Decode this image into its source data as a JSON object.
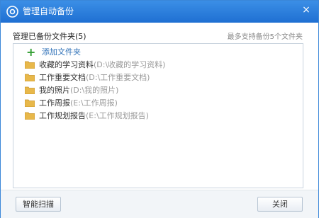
{
  "window": {
    "title": "管理自动备份",
    "close_glyph": "×"
  },
  "header": {
    "left_label": "管理已备份文件夹(5)",
    "right_hint": "最多支持备份5个文件夹"
  },
  "list": {
    "add_label": "添加文件夹",
    "add_icon": "plus-icon",
    "folders": [
      {
        "name": "收藏的学习资料",
        "path": "(D:\\收藏的学习资料)"
      },
      {
        "name": "工作重要文档",
        "path": "(D:\\工作重要文档)"
      },
      {
        "name": "我的照片",
        "path": "(D:\\我的照片)"
      },
      {
        "name": "工作周报",
        "path": "(E:\\工作周报)"
      },
      {
        "name": "工作规划报告",
        "path": "(E:\\工作规划报告)"
      }
    ]
  },
  "footer": {
    "scan_button": "智能扫描",
    "close_button": "关闭"
  },
  "colors": {
    "titlebar": "#1f6fd2",
    "folder": "#e8b84a",
    "add_plus": "#2f9d2f"
  }
}
